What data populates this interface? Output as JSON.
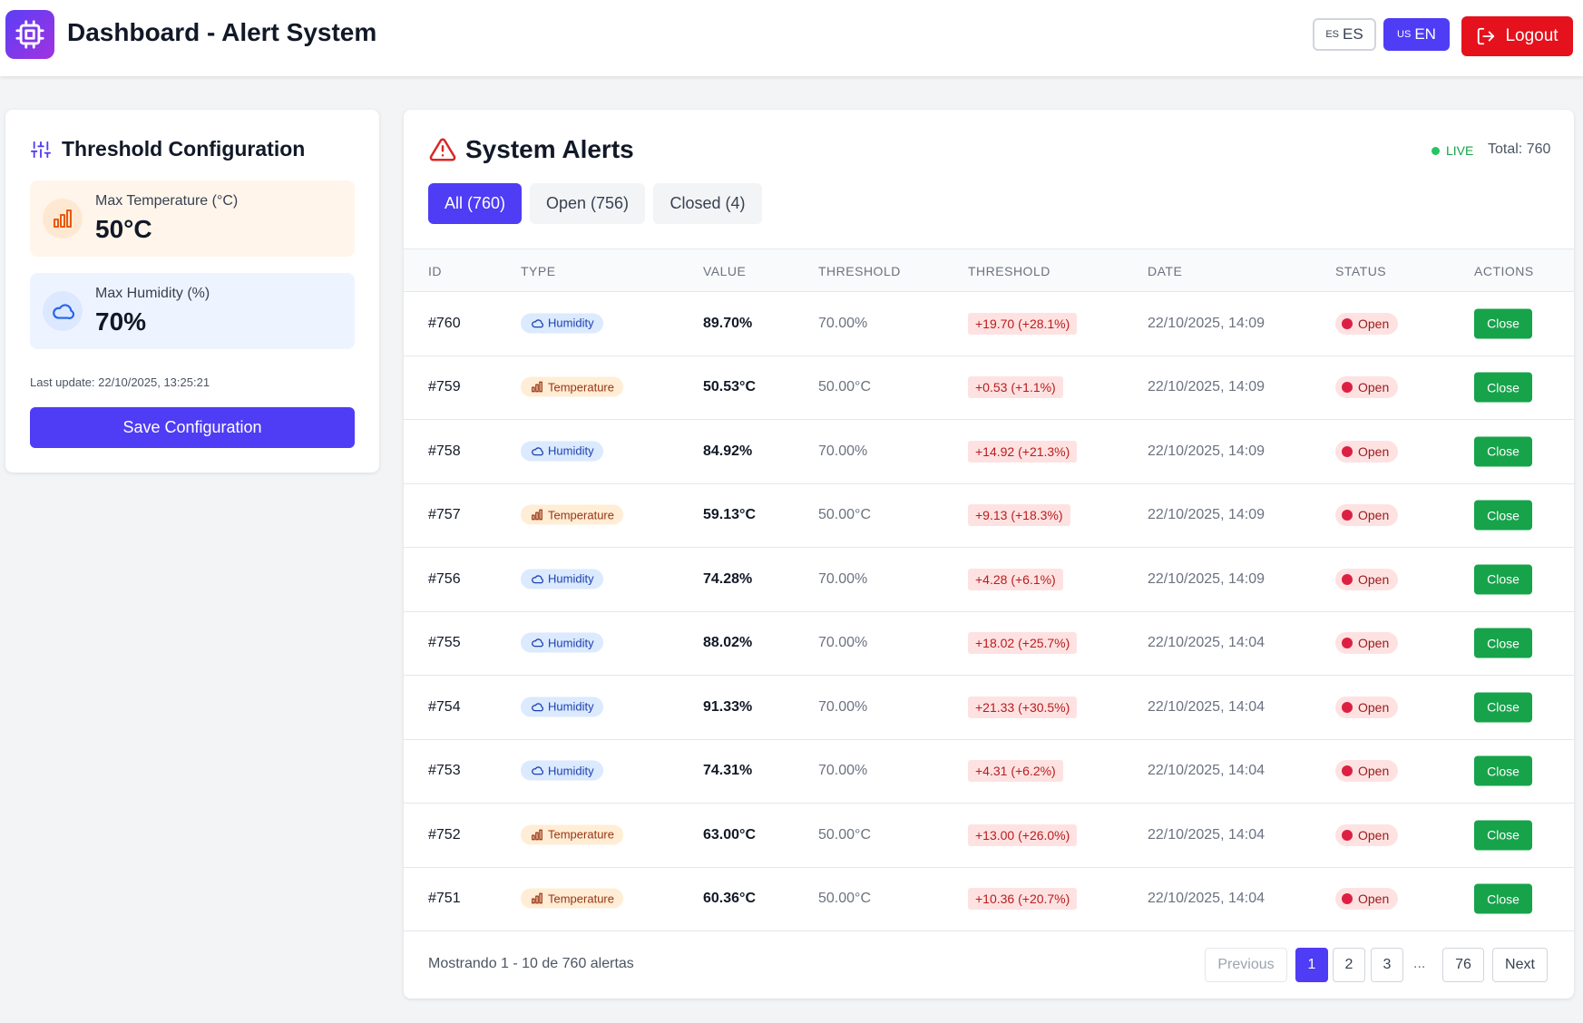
{
  "header": {
    "title": "Dashboard - Alert System",
    "lang_es_code": "ES",
    "lang_es_label": "ES",
    "lang_en_code": "US",
    "lang_en_label": "EN",
    "logout_label": "Logout"
  },
  "config": {
    "title": "Threshold Configuration",
    "temp_label": "Max Temperature (°C)",
    "temp_value": "50°C",
    "hum_label": "Max Humidity (%)",
    "hum_value": "70%",
    "last_update": "Last update: 22/10/2025, 13:25:21",
    "save_label": "Save Configuration"
  },
  "alerts": {
    "title": "System Alerts",
    "live_label": "LIVE",
    "total_label": "Total: 760",
    "tabs": [
      {
        "label": "All (760)"
      },
      {
        "label": "Open (756)"
      },
      {
        "label": "Closed (4)"
      }
    ],
    "columns": [
      "ID",
      "TYPE",
      "VALUE",
      "THRESHOLD",
      "THRESHOLD",
      "DATE",
      "STATUS",
      "ACTIONS"
    ],
    "rows": [
      {
        "id": "#760",
        "type": "Humidity",
        "kind": "humidity",
        "value": "89.70%",
        "threshold": "70.00%",
        "diff": "+19.70 (+28.1%)",
        "date": "22/10/2025, 14:09",
        "status": "Open",
        "action": "Close"
      },
      {
        "id": "#759",
        "type": "Temperature",
        "kind": "temperature",
        "value": "50.53°C",
        "threshold": "50.00°C",
        "diff": "+0.53 (+1.1%)",
        "date": "22/10/2025, 14:09",
        "status": "Open",
        "action": "Close"
      },
      {
        "id": "#758",
        "type": "Humidity",
        "kind": "humidity",
        "value": "84.92%",
        "threshold": "70.00%",
        "diff": "+14.92 (+21.3%)",
        "date": "22/10/2025, 14:09",
        "status": "Open",
        "action": "Close"
      },
      {
        "id": "#757",
        "type": "Temperature",
        "kind": "temperature",
        "value": "59.13°C",
        "threshold": "50.00°C",
        "diff": "+9.13 (+18.3%)",
        "date": "22/10/2025, 14:09",
        "status": "Open",
        "action": "Close"
      },
      {
        "id": "#756",
        "type": "Humidity",
        "kind": "humidity",
        "value": "74.28%",
        "threshold": "70.00%",
        "diff": "+4.28 (+6.1%)",
        "date": "22/10/2025, 14:09",
        "status": "Open",
        "action": "Close"
      },
      {
        "id": "#755",
        "type": "Humidity",
        "kind": "humidity",
        "value": "88.02%",
        "threshold": "70.00%",
        "diff": "+18.02 (+25.7%)",
        "date": "22/10/2025, 14:04",
        "status": "Open",
        "action": "Close"
      },
      {
        "id": "#754",
        "type": "Humidity",
        "kind": "humidity",
        "value": "91.33%",
        "threshold": "70.00%",
        "diff": "+21.33 (+30.5%)",
        "date": "22/10/2025, 14:04",
        "status": "Open",
        "action": "Close"
      },
      {
        "id": "#753",
        "type": "Humidity",
        "kind": "humidity",
        "value": "74.31%",
        "threshold": "70.00%",
        "diff": "+4.31 (+6.2%)",
        "date": "22/10/2025, 14:04",
        "status": "Open",
        "action": "Close"
      },
      {
        "id": "#752",
        "type": "Temperature",
        "kind": "temperature",
        "value": "63.00°C",
        "threshold": "50.00°C",
        "diff": "+13.00 (+26.0%)",
        "date": "22/10/2025, 14:04",
        "status": "Open",
        "action": "Close"
      },
      {
        "id": "#751",
        "type": "Temperature",
        "kind": "temperature",
        "value": "60.36°C",
        "threshold": "50.00°C",
        "diff": "+10.36 (+20.7%)",
        "date": "22/10/2025, 14:04",
        "status": "Open",
        "action": "Close"
      }
    ]
  },
  "pagination": {
    "info": "Mostrando 1 - 10 de 760 alertas",
    "previous": "Previous",
    "pages": [
      "1",
      "2",
      "3"
    ],
    "ellipsis": "...",
    "last_page": "76",
    "next": "Next"
  }
}
